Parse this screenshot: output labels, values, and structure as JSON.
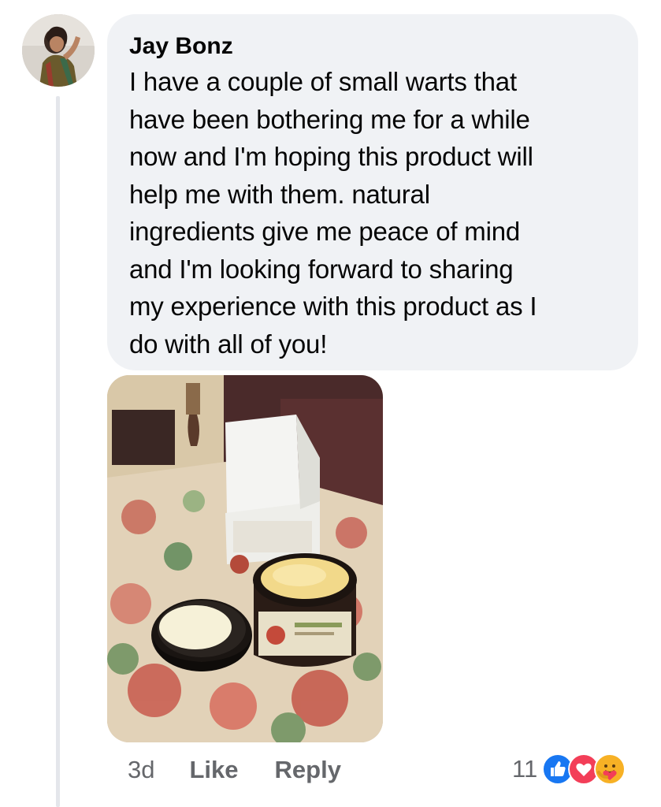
{
  "comment": {
    "author": "Jay Bonz",
    "text": "I have a couple of small warts that\nhave been bothering me for a while\nnow and I'm hoping this product will\nhelp me with them. natural\ningredients give me peace of mind\nand I'm looking forward to sharing\nmy experience with this product as I\ndo with all of you!",
    "timestamp": "3d",
    "like_label": "Like",
    "reply_label": "Reply",
    "reaction_count": "11",
    "reactions": [
      "like-icon",
      "love-icon",
      "care-icon"
    ]
  },
  "colors": {
    "bubble_bg": "#f0f2f5",
    "meta_text": "#65676b",
    "like_blue": "#1877f2",
    "love_red": "#f33e58",
    "care_yellow": "#f7b125"
  }
}
